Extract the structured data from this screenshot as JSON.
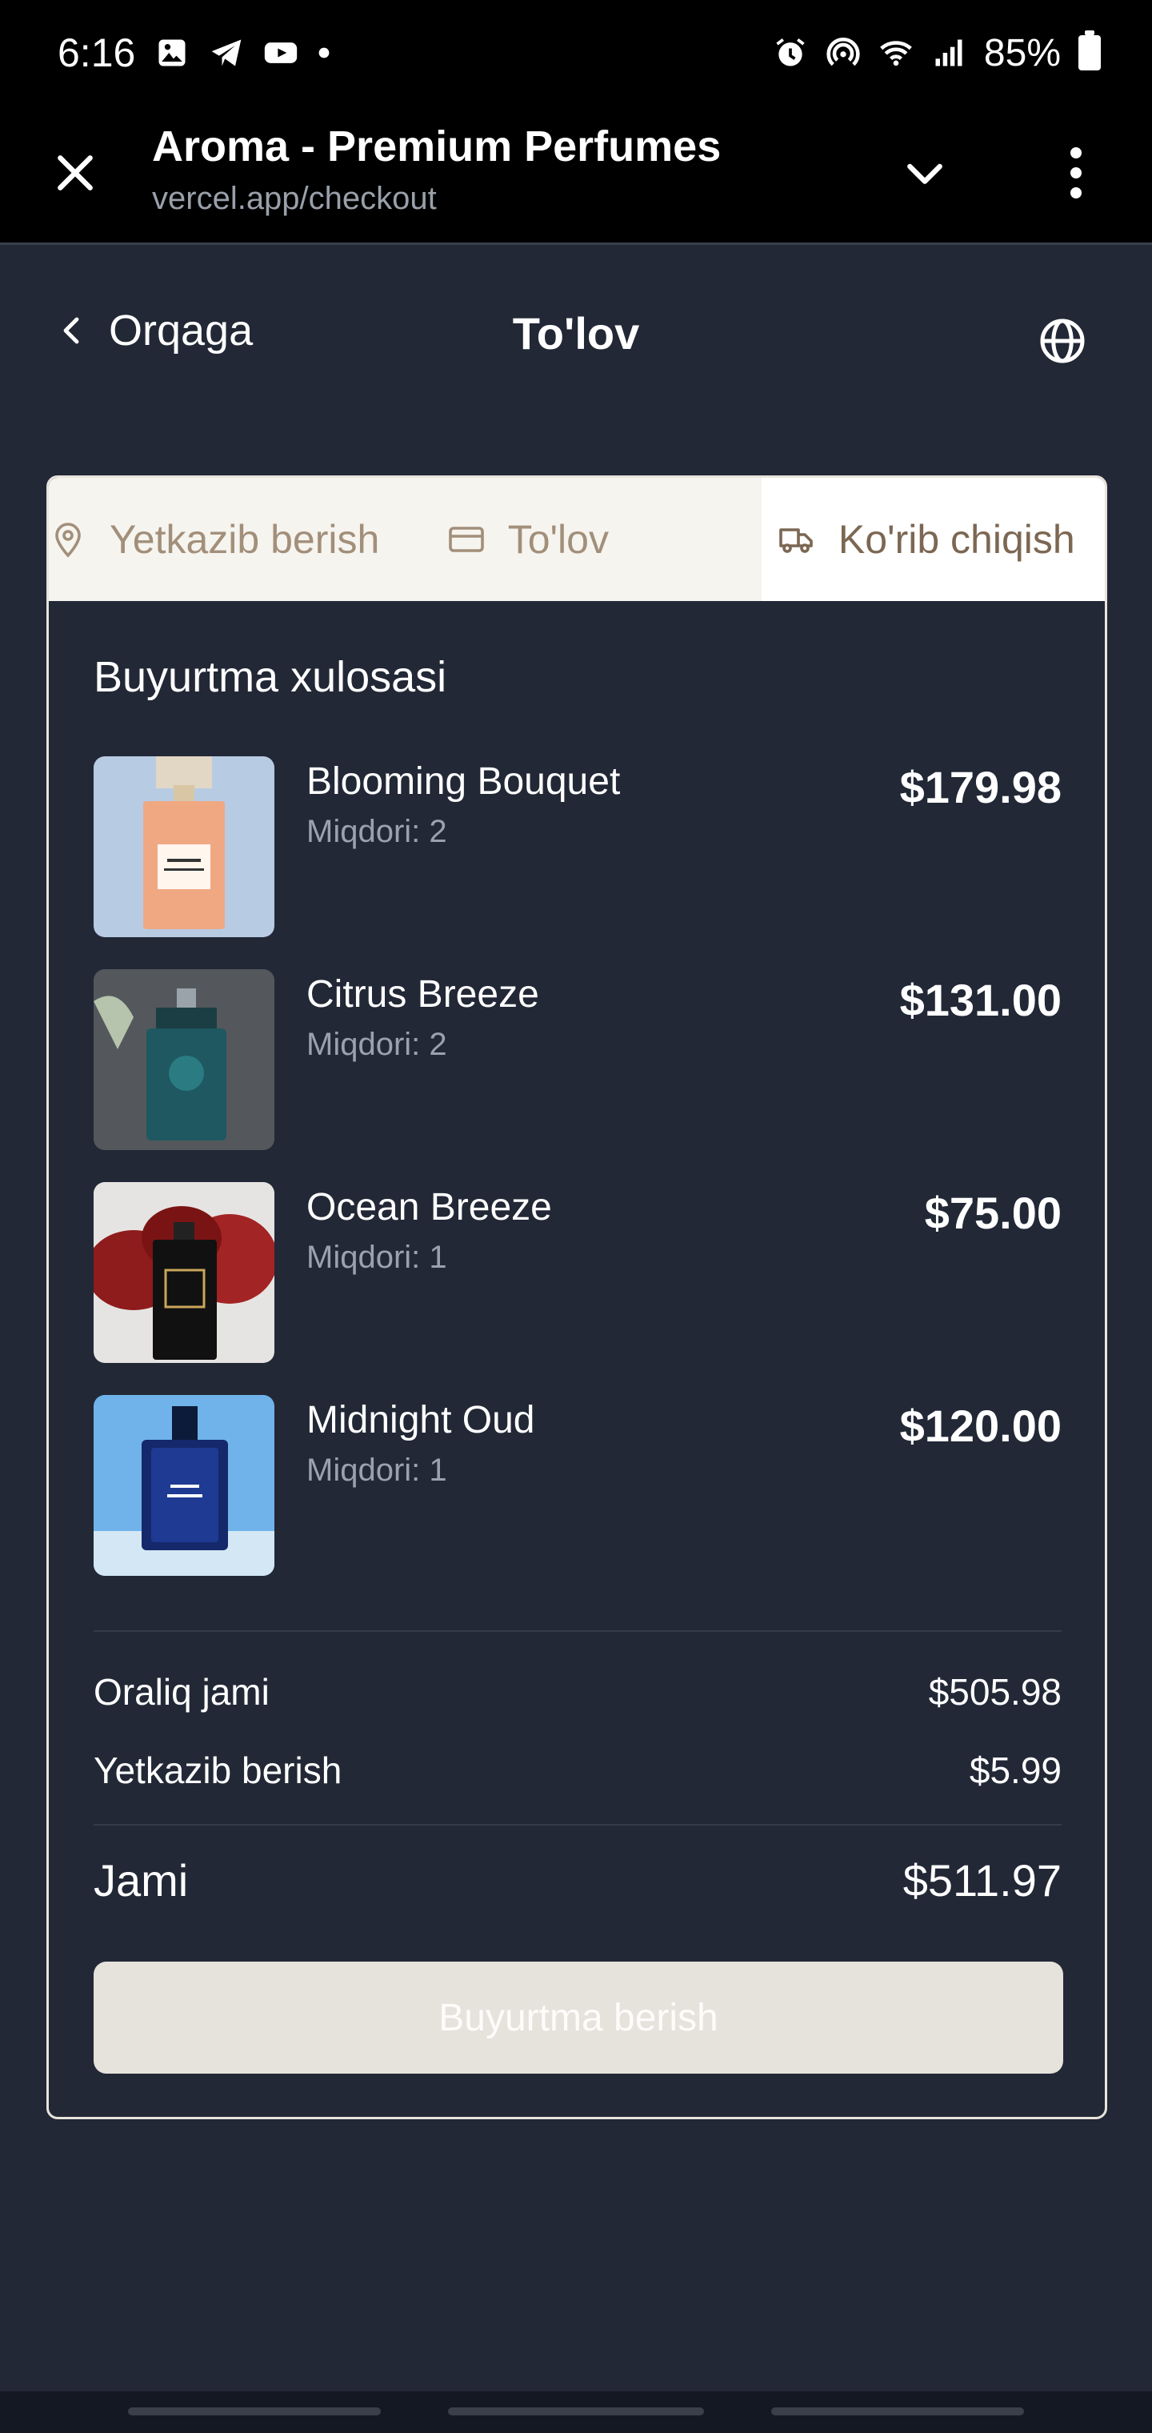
{
  "status_bar": {
    "time": "6:16",
    "battery": "85%",
    "icons": [
      "gallery-icon",
      "telegram-icon",
      "youtube-icon",
      "dot-icon",
      "alarm-icon",
      "hotspot-icon",
      "wifi-icon",
      "signal-icon",
      "battery-icon"
    ]
  },
  "browser": {
    "title": "Aroma - Premium Perfumes",
    "url": "vercel.app/checkout"
  },
  "header": {
    "back_label": "Orqaga",
    "title": "To'lov"
  },
  "steps": [
    {
      "label": "Yetkazib berish",
      "icon": "map-pin-icon"
    },
    {
      "label": "To'lov",
      "icon": "credit-card-icon"
    },
    {
      "label": "Ko'rib chiqish",
      "icon": "truck-icon"
    }
  ],
  "summary": {
    "title": "Buyurtma xulosasi",
    "items": [
      {
        "name": "Blooming Bouquet",
        "qty": "Miqdori: 2",
        "price": "$179.98"
      },
      {
        "name": "Citrus Breeze",
        "qty": "Miqdori: 2",
        "price": "$131.00"
      },
      {
        "name": "Ocean Breeze",
        "qty": "Miqdori: 1",
        "price": "$75.00"
      },
      {
        "name": "Midnight Oud",
        "qty": "Miqdori: 1",
        "price": "$120.00"
      }
    ],
    "subtotal_label": "Oraliq jami",
    "subtotal_value": "$505.98",
    "shipping_label": "Yetkazib berish",
    "shipping_value": "$5.99",
    "total_label": "Jami",
    "total_value": "$511.97",
    "button_label": "Buyurtma berish"
  },
  "colors": {
    "background": "#222836",
    "accent_brown": "#a28f7a",
    "button_bg": "#e6e2dc"
  }
}
